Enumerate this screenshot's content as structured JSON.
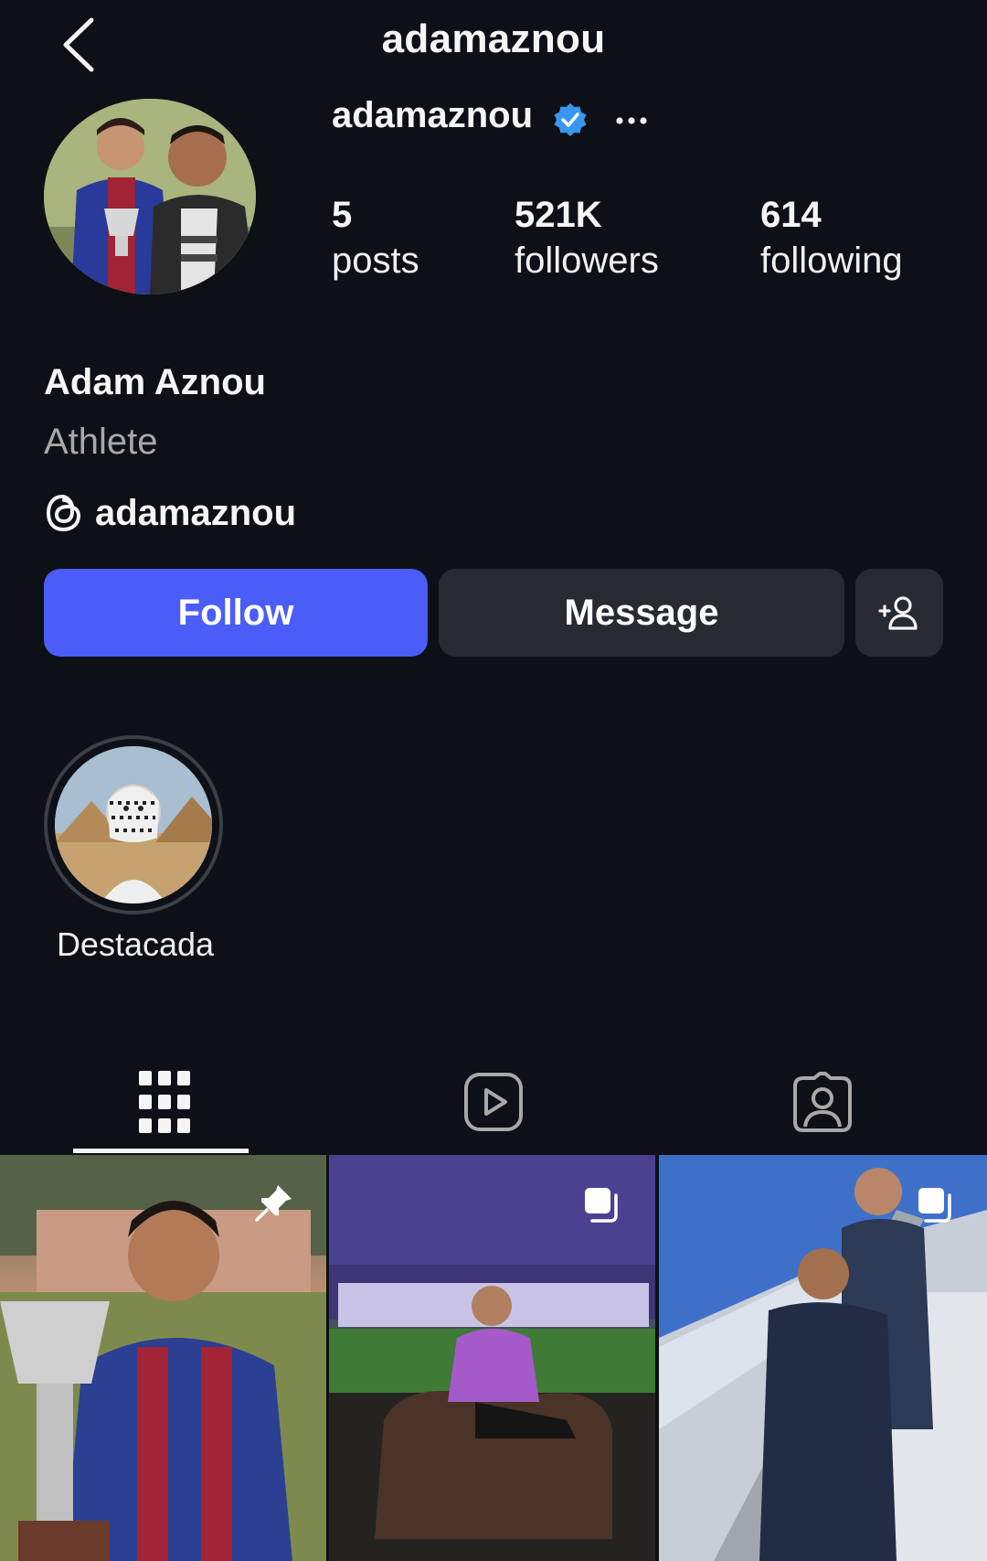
{
  "header": {
    "title": "adamaznou",
    "back_icon": "chevron-left-icon"
  },
  "profile": {
    "username": "adamaznou",
    "verified_icon": "verified-badge-icon",
    "verified_color": "#3897f0",
    "more_icon": "more-horizontal-icon",
    "stats": {
      "posts_count": "5",
      "posts_label": "posts",
      "followers_count": "521K",
      "followers_label": "followers",
      "following_count": "614",
      "following_label": "following"
    },
    "full_name": "Adam Aznou",
    "category": "Athlete",
    "threads_handle": "adamaznou",
    "threads_icon": "threads-icon"
  },
  "actions": {
    "follow_label": "Follow",
    "follow_color": "#4a5df9",
    "message_label": "Message",
    "add_user_icon": "add-person-icon"
  },
  "highlights": [
    {
      "label": "Destacada"
    }
  ],
  "tabs": [
    {
      "icon": "grid-icon",
      "selected": true
    },
    {
      "icon": "reels-icon",
      "selected": false
    },
    {
      "icon": "tagged-icon",
      "selected": false
    }
  ],
  "posts": [
    {
      "badge_icon": "pin-icon"
    },
    {
      "badge_icon": "carousel-icon"
    },
    {
      "badge_icon": "carousel-icon"
    }
  ]
}
